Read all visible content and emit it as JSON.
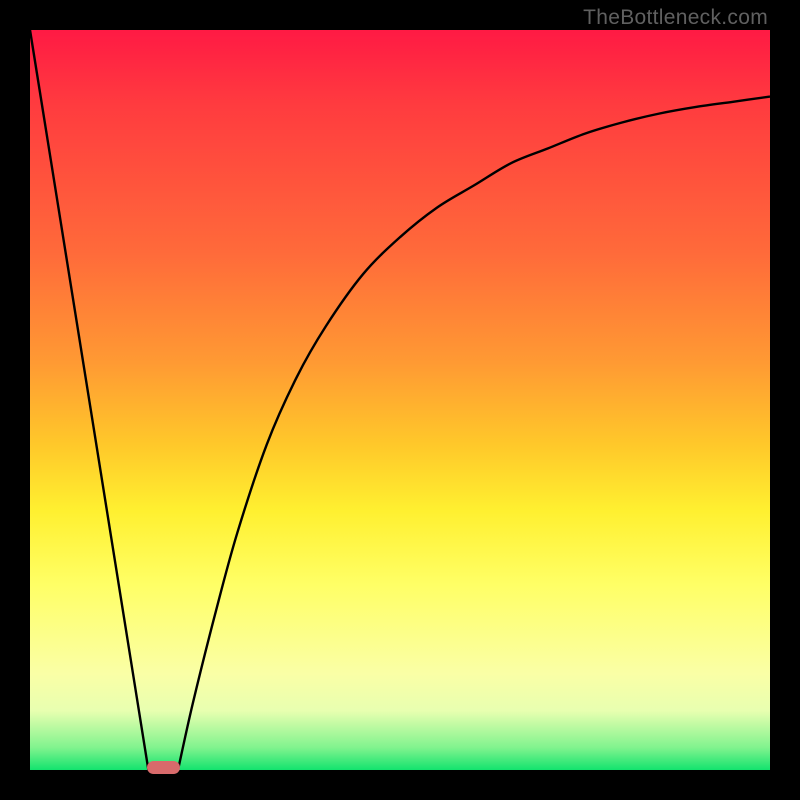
{
  "watermark": "TheBottleneck.com",
  "chart_data": {
    "type": "line",
    "title": "",
    "xlabel": "",
    "ylabel": "",
    "xlim": [
      0,
      100
    ],
    "ylim": [
      0,
      100
    ],
    "grid": false,
    "legend": false,
    "series": [
      {
        "name": "left-line",
        "x": [
          0,
          16
        ],
        "y": [
          100,
          0
        ]
      },
      {
        "name": "right-curve",
        "x": [
          20,
          22,
          25,
          28,
          32,
          36,
          40,
          45,
          50,
          55,
          60,
          65,
          70,
          75,
          80,
          85,
          90,
          95,
          100
        ],
        "y": [
          0,
          9,
          21,
          32,
          44,
          53,
          60,
          67,
          72,
          76,
          79,
          82,
          84,
          86,
          87.5,
          88.7,
          89.6,
          90.3,
          91
        ]
      }
    ],
    "marker": {
      "name": "bottleneck-marker",
      "x_center": 18,
      "width_pct": 4.5,
      "color": "#d86a6b"
    },
    "gradient_stops": [
      {
        "pos": 0,
        "color": "#ff1a44"
      },
      {
        "pos": 30,
        "color": "#ff6a3a"
      },
      {
        "pos": 56,
        "color": "#ffc82a"
      },
      {
        "pos": 75,
        "color": "#ffff66"
      },
      {
        "pos": 100,
        "color": "#13e36e"
      }
    ]
  }
}
